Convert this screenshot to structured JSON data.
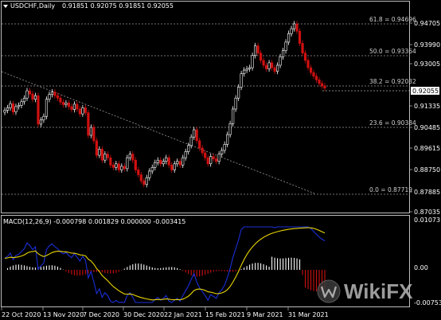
{
  "chart": {
    "header": {
      "icon": "triangle-down-icon",
      "symbol_text": "USDCHF,Daily",
      "ohlc_text": "0.91851 0.92075 0.91851 0.92055"
    },
    "fib_levels": [
      {
        "label": "61.8 = 0.94696",
        "value": 0.94696
      },
      {
        "label": "50.0 = 0.93364",
        "value": 0.93364
      },
      {
        "label": "38.2 = 0.92032",
        "value": 0.92032
      },
      {
        "label": "23.6 = 0.90384",
        "value": 0.90384
      },
      {
        "label": "0.0 = 0.87719",
        "value": 0.87719
      }
    ],
    "price_axis": [
      "0.94705",
      "0.93990",
      "0.93005",
      "0.92055",
      "0.91335",
      "0.90485",
      "0.89615",
      "0.88750",
      "0.87885",
      "0.87035"
    ],
    "current_price": "0.92055",
    "time_axis": [
      "22 Oct 2020",
      "13 Nov 2020",
      "7 Dec 2020",
      "30 Dec 2020",
      "22 Jan 2021",
      "15 Feb 2021",
      "9 Mar 2021",
      "31 Mar 2021"
    ],
    "colors": {
      "up": "#ffffff",
      "down": "#d01010",
      "grid": "#9a9a9a",
      "border": "#bdbdbd"
    }
  },
  "macd": {
    "header_text": "MACD(12,26,9) -0.000798 0.001829 0.000000 -0.003415",
    "axis": [
      "0.010731",
      "0.00",
      "-0.007533"
    ],
    "colors": {
      "macd_line": "#1a2fd6",
      "signal_line": "#e8d400",
      "hist_up": "#ffffff",
      "hist_down": "#d01010"
    }
  },
  "watermark": {
    "text": "WikiFX",
    "logo_icon": "wikifx-logo-icon"
  },
  "chart_data": {
    "type": "candlestick",
    "title": "USDCHF,Daily",
    "x": [
      "22 Oct 2020",
      "13 Nov 2020",
      "7 Dec 2020",
      "30 Dec 2020",
      "22 Jan 2021",
      "15 Feb 2021",
      "9 Mar 2021",
      "31 Mar 2021"
    ],
    "ylim": [
      0.87035,
      0.94705
    ],
    "series": [
      {
        "name": "price",
        "values": [
          0.9115,
          0.9125,
          0.9142,
          0.9108,
          0.913,
          0.9135,
          0.915,
          0.9165,
          0.9195,
          0.9182,
          0.916,
          0.9175,
          0.9058,
          0.9075,
          0.909,
          0.916,
          0.918,
          0.919,
          0.9175,
          0.9165,
          0.9148,
          0.9138,
          0.9145,
          0.913,
          0.9118,
          0.914,
          0.912,
          0.91,
          0.9125,
          0.9105,
          0.9012,
          0.9045,
          0.899,
          0.893,
          0.8955,
          0.891,
          0.8935,
          0.892,
          0.889,
          0.888,
          0.8895,
          0.887,
          0.8885,
          0.8875,
          0.892,
          0.8935,
          0.891,
          0.887,
          0.885,
          0.8825,
          0.881,
          0.8838,
          0.8865,
          0.888,
          0.89,
          0.891,
          0.8895,
          0.8905,
          0.892,
          0.889,
          0.887,
          0.8895,
          0.8905,
          0.889,
          0.892,
          0.8945,
          0.897,
          0.9005,
          0.9035,
          0.899,
          0.896,
          0.894,
          0.892,
          0.8895,
          0.8925,
          0.8915,
          0.8905,
          0.8935,
          0.895,
          0.8975,
          0.9015,
          0.906,
          0.912,
          0.9165,
          0.921,
          0.9265,
          0.928,
          0.9285,
          0.929,
          0.934,
          0.938,
          0.935,
          0.932,
          0.93,
          0.9285,
          0.931,
          0.929,
          0.9275,
          0.93,
          0.9335,
          0.936,
          0.9395,
          0.943,
          0.945,
          0.947,
          0.944,
          0.939,
          0.935,
          0.932,
          0.929,
          0.927,
          0.9255,
          0.924,
          0.9225,
          0.9215,
          0.9206
        ]
      }
    ],
    "fib_levels": [
      0.94696,
      0.93364,
      0.92032,
      0.90384,
      0.87719
    ],
    "current_price": 0.92055,
    "macd": {
      "macd": -0.000798,
      "signal": 0.001829,
      "ylim": [
        -0.007533,
        0.010731
      ]
    },
    "grid": true
  }
}
